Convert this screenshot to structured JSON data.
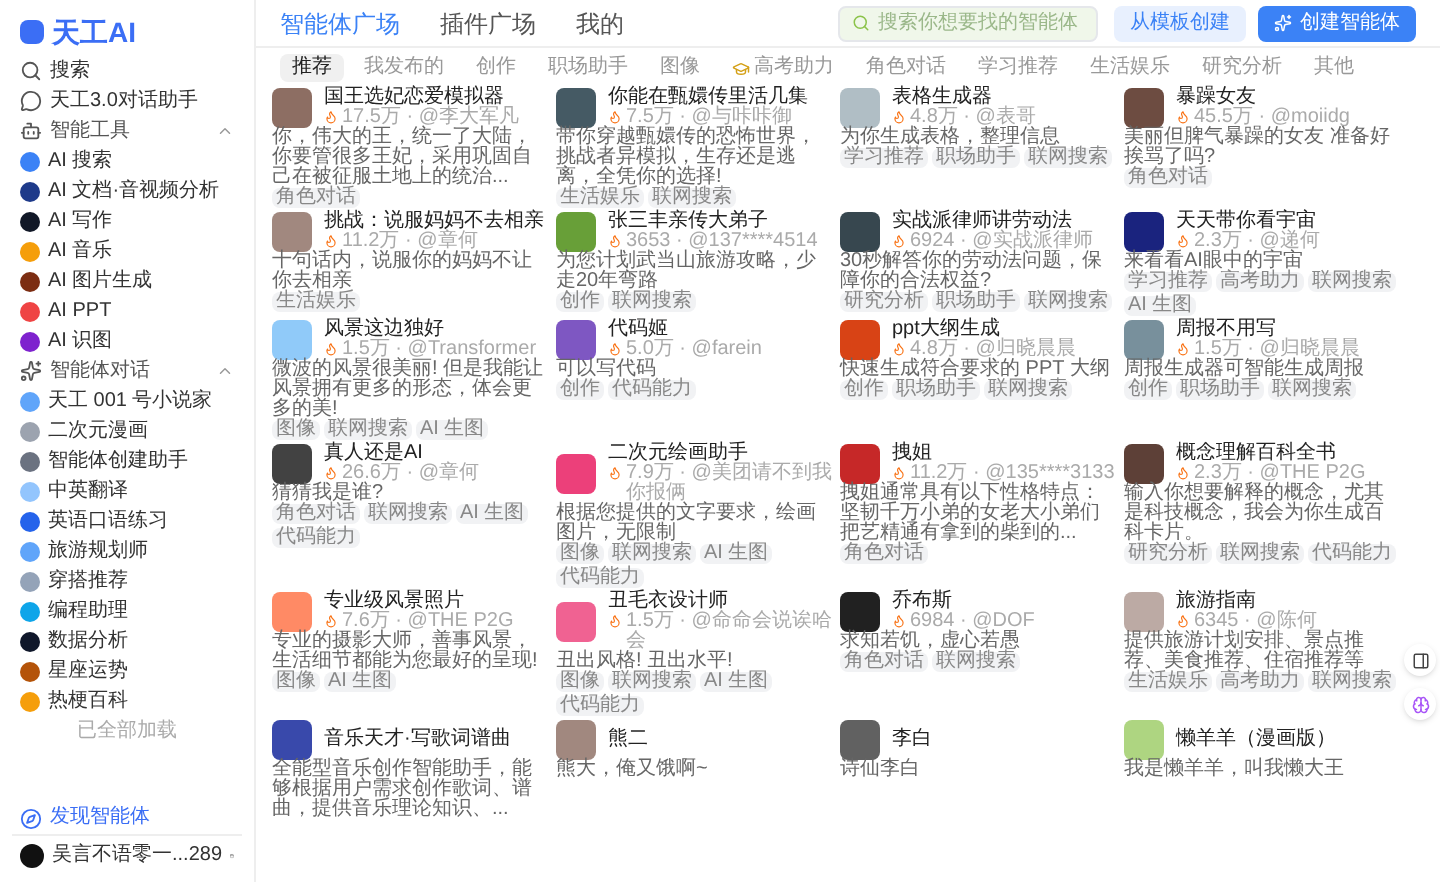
{
  "sidebar": {
    "logo": "天工AI",
    "top_items": [
      {
        "kind": "search",
        "label": "搜索"
      },
      {
        "kind": "chat",
        "label": "天工3.0对话助手"
      }
    ],
    "groups": [
      {
        "kind": "tools",
        "title": "智能工具",
        "expanded": true,
        "items": [
          "AI 搜索",
          "AI 文档·音视频分析",
          "AI 写作",
          "AI 音乐",
          "AI 图片生成",
          "AI PPT",
          "AI 识图"
        ]
      },
      {
        "kind": "agents",
        "title": "智能体对话",
        "expanded": true,
        "items": [
          "天工 001 号小说家",
          "二次元漫画",
          "智能体创建助手",
          "中英翻译",
          "英语口语练习",
          "旅游规划师",
          "穿搭推荐",
          "编程助理",
          "数据分析",
          "星座运势",
          "热梗百科"
        ]
      }
    ],
    "loaded_note": "已全部加载",
    "discover": "发现智能体",
    "user": "吴言不语零一...289"
  },
  "top_tabs": [
    {
      "label": "智能体广场",
      "selected": true
    },
    {
      "label": "插件广场",
      "selected": false
    },
    {
      "label": "我的",
      "selected": false
    }
  ],
  "search": {
    "placeholder": "搜索你想要找的智能体"
  },
  "buttons": [
    {
      "kind": "secondary",
      "label": "从模板创建"
    },
    {
      "kind": "primary",
      "label": "创建智能体"
    }
  ],
  "categories": [
    {
      "label": "推荐",
      "selected": true
    },
    {
      "label": "我发布的",
      "selected": false
    },
    {
      "label": "创作",
      "selected": false
    },
    {
      "label": "职场助手",
      "selected": false
    },
    {
      "label": "图像",
      "selected": false
    },
    {
      "label": "高考助力",
      "selected": false,
      "icon": true
    },
    {
      "label": "角色对话",
      "selected": false
    },
    {
      "label": "学习推荐",
      "selected": false
    },
    {
      "label": "生活娱乐",
      "selected": false
    },
    {
      "label": "研究分析",
      "selected": false
    },
    {
      "label": "其他",
      "selected": false
    }
  ],
  "agents": [
    {
      "title": "国王选妃恋爱模拟器",
      "description": "你，伟大的王，统一了大陆，你要管很多王妃，采用巩固自己在被征服土地上的统治...",
      "tags": [
        "角色对话"
      ],
      "stats": "17.5万 · @李大军凡"
    },
    {
      "title": "你能在甄嬛传里活几集",
      "description": "带你穿越甄嬛传的恐怖世界，挑战者异模拟，生存还是逃离，全凭你的选择!",
      "tags": [
        "生活娱乐",
        "联网搜索"
      ],
      "stats": "7.5万 · @与咔咔御"
    },
    {
      "title": "表格生成器",
      "description": "为你生成表格，整理信息",
      "tags": [
        "学习推荐",
        "职场助手",
        "联网搜索"
      ],
      "stats": "4.8万 · @表哥"
    },
    {
      "title": "暴躁女友",
      "description": "美丽但脾气暴躁的女友 准备好挨骂了吗?",
      "tags": [
        "角色对话"
      ],
      "stats": "45.5万 · @moiidg"
    },
    {
      "title": "挑战：说服妈妈不去相亲",
      "description": "十句话内，说服你的妈妈不让你去相亲",
      "tags": [
        "生活娱乐"
      ],
      "stats": "11.2万 · @章何"
    },
    {
      "title": "张三丰亲传大弟子",
      "description": "为您计划武当山旅游攻略，少走20年弯路",
      "tags": [
        "创作",
        "联网搜索"
      ],
      "stats": "3653 · @137****4514"
    },
    {
      "title": "实战派律师讲劳动法",
      "description": "30秒解答你的劳动法问题，保障你的合法权益?",
      "tags": [
        "研究分析",
        "职场助手",
        "联网搜索"
      ],
      "stats": "6924 · @实战派律师"
    },
    {
      "title": "天天带你看宇宙",
      "description": "来看看AI眼中的宇宙",
      "tags": [
        "学习推荐",
        "高考助力",
        "联网搜索",
        "AI 生图"
      ],
      "stats": "2.3万 · @递何"
    },
    {
      "title": "风景这边独好",
      "description": "微波的风景很美丽! 但是我能让风景拥有更多的形态，体会更多的美!",
      "tags": [
        "图像",
        "联网搜索",
        "AI 生图"
      ],
      "stats": "1.5万 · @Transformer"
    },
    {
      "title": "代码姬",
      "description": "可以写代码",
      "tags": [
        "创作",
        "代码能力"
      ],
      "stats": "5.0万 · @farein"
    },
    {
      "title": "ppt大纲生成",
      "description": "快速生成符合要求的 PPT 大纲",
      "tags": [
        "创作",
        "职场助手",
        "联网搜索"
      ],
      "stats": "4.8万 · @归晓晨晨"
    },
    {
      "title": "周报不用写",
      "description": "周报生成器可智能生成周报",
      "tags": [
        "创作",
        "职场助手",
        "联网搜索"
      ],
      "stats": "1.5万 · @归晓晨晨"
    },
    {
      "title": "真人还是AI",
      "description": "猜猜我是谁?",
      "tags": [
        "角色对话",
        "联网搜索",
        "AI 生图",
        "代码能力"
      ],
      "stats": "26.6万 · @章何"
    },
    {
      "title": "二次元绘画助手",
      "description": "根据您提供的文字要求，绘画图片，无限制",
      "tags": [
        "图像",
        "联网搜索",
        "AI 生图",
        "代码能力"
      ],
      "stats": "7.9万 · @美团请不到我你报俩"
    },
    {
      "title": "拽姐",
      "description": "拽姐通常具有以下性格特点：坚韧千万小弟的女老大小弟们把艺精通有拿到的柴到的...",
      "tags": [
        "角色对话"
      ],
      "stats": "11.2万 · @135****3133"
    },
    {
      "title": "概念理解百科全书",
      "description": "输入你想要解释的概念，尤其是科技概念，我会为你生成百科卡片。",
      "tags": [
        "研究分析",
        "联网搜索",
        "代码能力"
      ],
      "stats": "2.3万 · @THE P2G"
    },
    {
      "title": "专业级风景照片",
      "description": "专业的摄影大师，善事风景，生活细节都能为您最好的呈现!",
      "tags": [
        "图像",
        "AI 生图"
      ],
      "stats": "7.6万 · @THE P2G"
    },
    {
      "title": "丑毛衣设计师",
      "description": "丑出风格! 丑出水平!",
      "tags": [
        "图像",
        "联网搜索",
        "AI 生图",
        "代码能力"
      ],
      "stats": "1.5万 · @命命会说诶哈会"
    },
    {
      "title": "乔布斯",
      "description": "求知若饥，虚心若愚",
      "tags": [
        "角色对话",
        "联网搜索"
      ],
      "stats": "6984 · @DOF"
    },
    {
      "title": "旅游指南",
      "description": "提供旅游计划安排、景点推荐、美食推荐、住宿推荐等",
      "tags": [
        "生活娱乐",
        "高考助力",
        "联网搜索"
      ],
      "stats": "6345 · @陈何"
    },
    {
      "title": "音乐天才·写歌词谱曲",
      "description": "全能型音乐创作智能助手，能够根据用户需求创作歌词、谱曲，提供音乐理论知识、..."
    },
    {
      "title": "熊二",
      "description": "熊大，俺又饿啊~"
    },
    {
      "title": "李白",
      "description": "诗仙李白"
    },
    {
      "title": "懒羊羊（漫画版）",
      "description": "我是懒羊羊，叫我懒大王"
    }
  ]
}
